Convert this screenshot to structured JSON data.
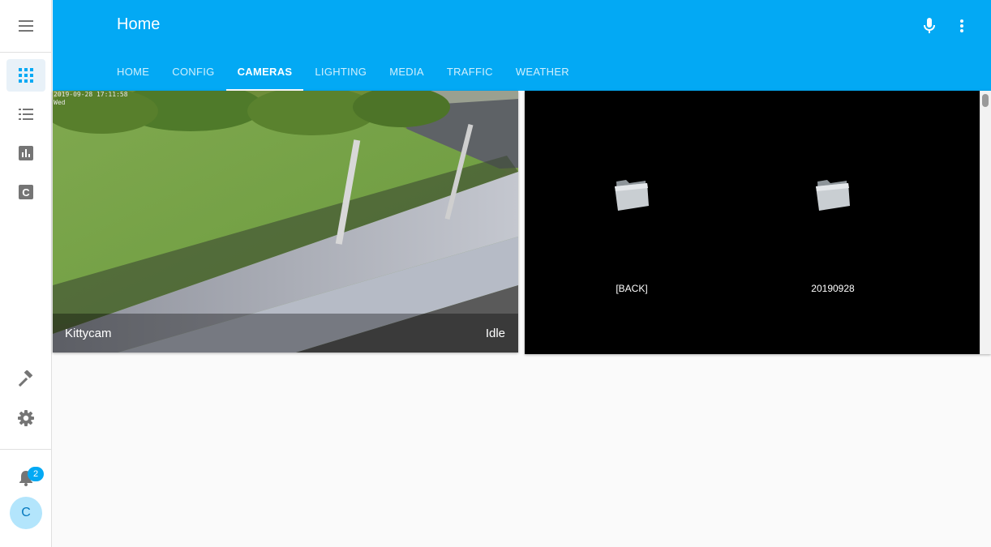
{
  "app": {
    "title": "Home"
  },
  "header": {
    "mic_icon": "microphone-icon",
    "menu_icon": "more-vertical-icon"
  },
  "tabs": [
    {
      "label": "HOME"
    },
    {
      "label": "CONFIG"
    },
    {
      "label": "CAMERAS",
      "active": true
    },
    {
      "label": "LIGHTING"
    },
    {
      "label": "MEDIA"
    },
    {
      "label": "TRAFFIC"
    },
    {
      "label": "WEATHER"
    }
  ],
  "sidebar": {
    "items": [
      {
        "icon": "grid-icon",
        "active": true
      },
      {
        "icon": "list-icon"
      },
      {
        "icon": "bar-chart-icon"
      },
      {
        "icon": "config-c-icon"
      }
    ],
    "bottom_items": [
      {
        "icon": "hammer-icon"
      },
      {
        "icon": "gear-icon"
      }
    ],
    "notifications": {
      "count": "2"
    },
    "user": {
      "initial": "C"
    }
  },
  "camera": {
    "name": "Kittycam",
    "state": "Idle",
    "timestamp": "2019-09-28 17:11:58",
    "timestamp_sub": "Wed"
  },
  "browser": {
    "folders": [
      {
        "label": "[BACK]"
      },
      {
        "label": "20190928"
      }
    ]
  },
  "colors": {
    "accent": "#03a9f4",
    "sidebar_active_bg": "#e8f1f8",
    "avatar_bg": "#b3e5fc"
  }
}
